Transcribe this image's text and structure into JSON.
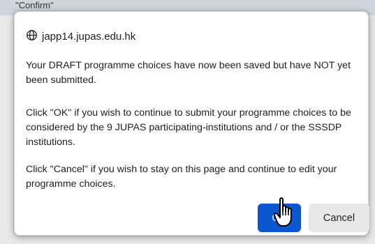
{
  "backdrop": {
    "partial_text": "\"Confirm\""
  },
  "dialog": {
    "origin": "japp14.jupas.edu.hk",
    "origin_icon": "globe-icon",
    "message_paragraphs": [
      "Your DRAFT programme choices have now been saved but have NOT yet been submitted.",
      "Click \"OK\" if you wish to continue to submit your programme choices to be considered by the 9 JUPAS participating-institutions and / or the SSSDP institutions.",
      "Click \"Cancel\" if you wish to stay on this page and continue to edit your programme choices."
    ],
    "ok_label": "OK",
    "cancel_label": "Cancel",
    "cursor_icon": "hand-pointer-icon"
  },
  "colors": {
    "ok_button": "#0b57d0",
    "cancel_button": "#e8e8e8"
  }
}
